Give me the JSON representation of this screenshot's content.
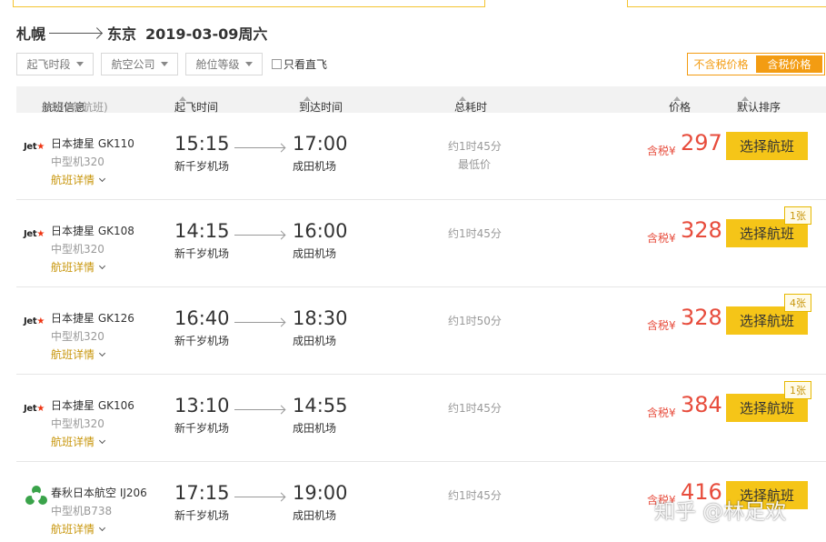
{
  "route": {
    "from": "札幌",
    "to": "东京",
    "date": "2019-03-09周六"
  },
  "filters": [
    {
      "label": "起飞时段"
    },
    {
      "label": "航空公司"
    },
    {
      "label": "舱位等级"
    }
  ],
  "direct_only": {
    "label": "只看直飞",
    "checked": false
  },
  "tax_toggle": {
    "off": "不含税价格",
    "on": "含税价格"
  },
  "table_header": {
    "flight_info": "航班信息",
    "count": "(共87条航班)",
    "depart": "起飞时间",
    "arrive": "到达时间",
    "duration": "总耗时",
    "price": "价格",
    "sort": "默认排序"
  },
  "flights": [
    {
      "logo": "Jet",
      "airline": "日本捷星 GK110",
      "plane": "中型机320",
      "detail": "航班详情",
      "dep_time": "15:15",
      "dep_airport": "新千岁机场",
      "arr_time": "17:00",
      "arr_airport": "成田机场",
      "duration": "约1时45分",
      "note": "最低价",
      "tax": "含税¥",
      "price": "297",
      "button": "选择航班",
      "seats": ""
    },
    {
      "logo": "Jet",
      "airline": "日本捷星 GK108",
      "plane": "中型机320",
      "detail": "航班详情",
      "dep_time": "14:15",
      "dep_airport": "新千岁机场",
      "arr_time": "16:00",
      "arr_airport": "成田机场",
      "duration": "约1时45分",
      "note": "",
      "tax": "含税¥",
      "price": "328",
      "button": "选择航班",
      "seats": "1张"
    },
    {
      "logo": "Jet",
      "airline": "日本捷星 GK126",
      "plane": "中型机320",
      "detail": "航班详情",
      "dep_time": "16:40",
      "dep_airport": "新千岁机场",
      "arr_time": "18:30",
      "arr_airport": "成田机场",
      "duration": "约1时50分",
      "note": "",
      "tax": "含税¥",
      "price": "328",
      "button": "选择航班",
      "seats": "4张"
    },
    {
      "logo": "Jet",
      "airline": "日本捷星 GK106",
      "plane": "中型机320",
      "detail": "航班详情",
      "dep_time": "13:10",
      "dep_airport": "新千岁机场",
      "arr_time": "14:55",
      "arr_airport": "成田机场",
      "duration": "约1时45分",
      "note": "",
      "tax": "含税¥",
      "price": "384",
      "button": "选择航班",
      "seats": "1张"
    },
    {
      "logo": "spring",
      "airline": "春秋日本航空 IJ206",
      "plane": "中型机B738",
      "detail": "航班详情",
      "dep_time": "17:15",
      "dep_airport": "新千岁机场",
      "arr_time": "19:00",
      "arr_airport": "成田机场",
      "duration": "约1时45分",
      "note": "",
      "tax": "含税¥",
      "price": "416",
      "button": "选择航班",
      "seats": ""
    }
  ],
  "watermark": "知乎 @林足欢",
  "colors": {
    "accent": "#f39c12",
    "button": "#f5c518",
    "price": "#e74c3c",
    "detail": "#c8960c"
  }
}
